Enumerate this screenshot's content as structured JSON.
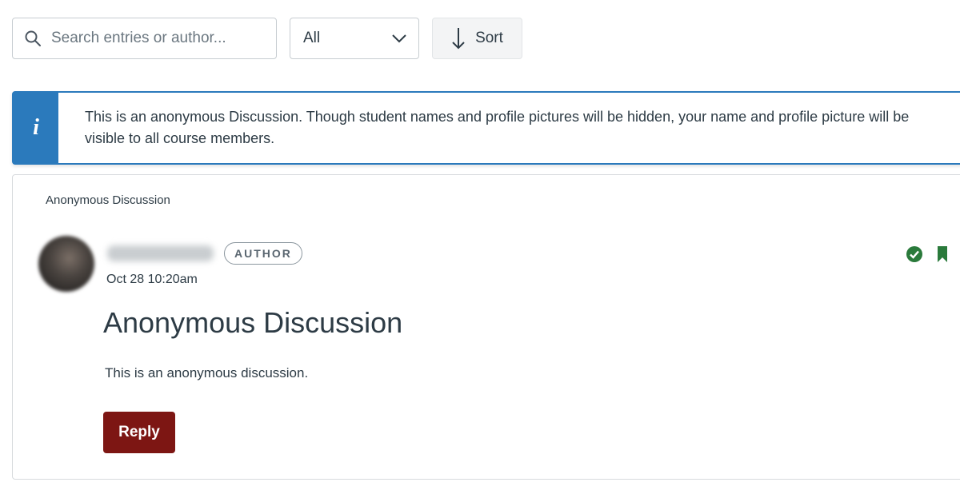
{
  "toolbar": {
    "search_placeholder": "Search entries or author...",
    "filter_value": "All",
    "sort_label": "Sort"
  },
  "alert": {
    "text": "This is an anonymous Discussion. Though student names and profile pictures will be hidden, your name and profile picture will be visible to all course members.",
    "icon": "info-icon"
  },
  "card": {
    "label": "Anonymous Discussion",
    "author_badge": "AUTHOR",
    "date": "Oct 28 10:20am",
    "title": "Anonymous Discussion",
    "body": "This is an anonymous discussion.",
    "reply_label": "Reply",
    "status_icons": [
      "check-circle-icon",
      "bookmark-icon"
    ]
  },
  "colors": {
    "info_blue": "#2b7abc",
    "reply_red": "#7d1613",
    "status_green": "#2a7a3b",
    "text": "#2d3b45"
  }
}
